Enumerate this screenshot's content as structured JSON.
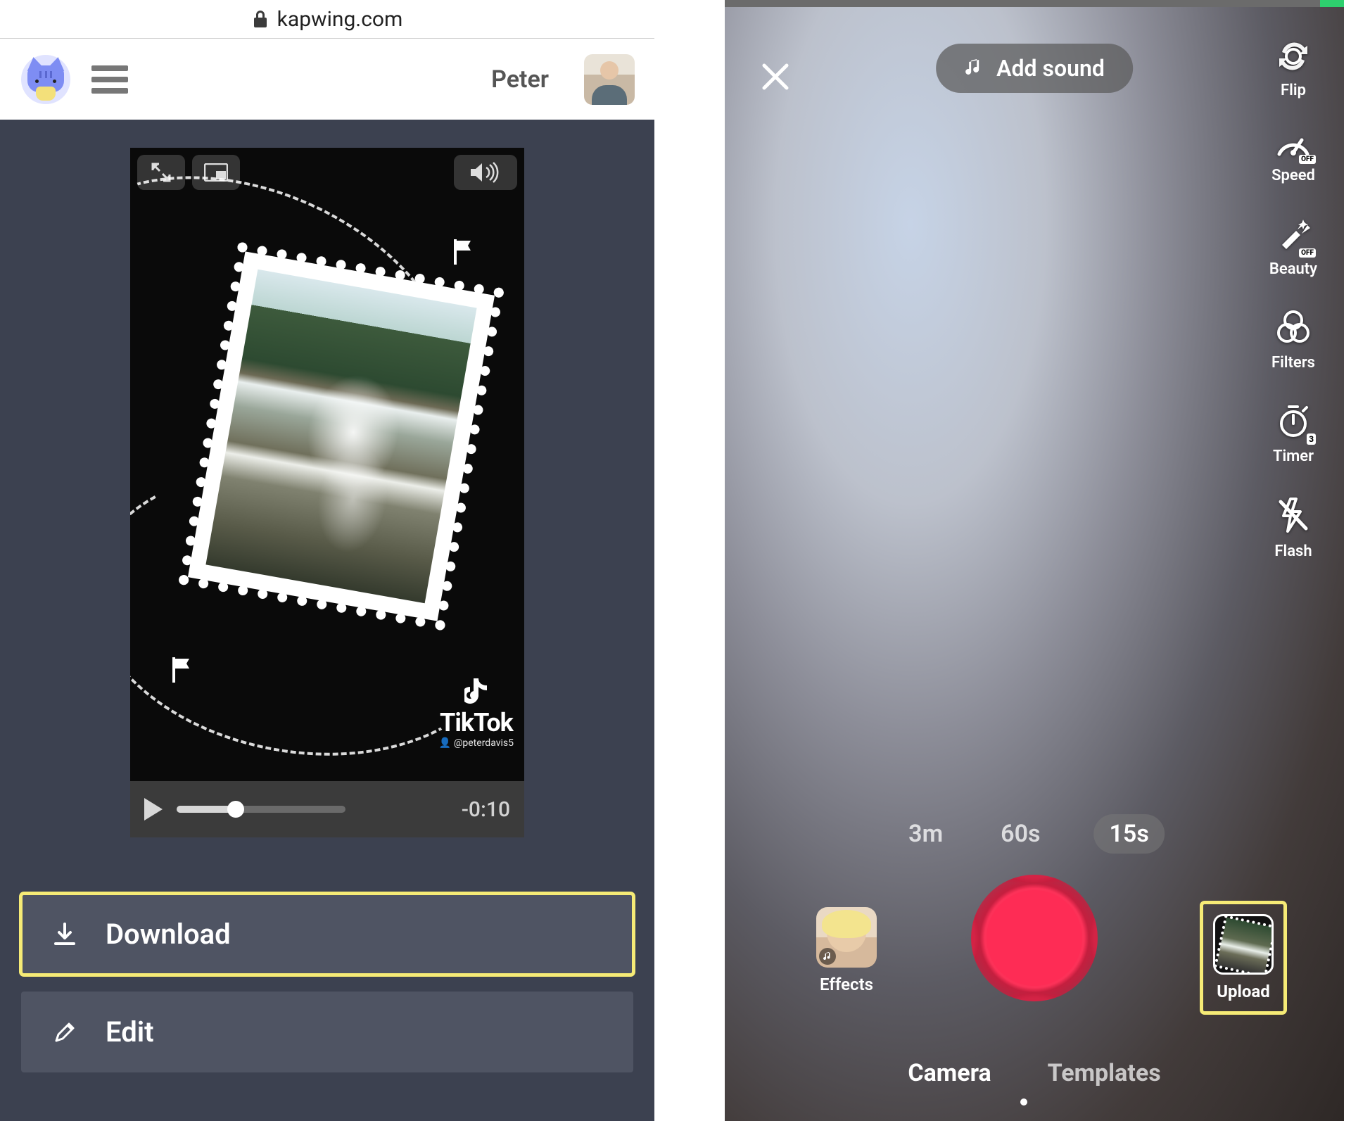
{
  "kapwing": {
    "url_domain": "kapwing.com",
    "username": "Peter",
    "watermark": {
      "brand": "TikTok",
      "handle": "@peterdavis5"
    },
    "player": {
      "timecode": "-0:10"
    },
    "buttons": {
      "download": "Download",
      "edit": "Edit"
    },
    "icons": {
      "lock": "lock-icon",
      "menu": "hamburger-icon",
      "fullscreen": "fullscreen-icon",
      "pip": "pip-icon",
      "volume": "volume-icon",
      "play": "play-icon",
      "download_icon": "download-icon",
      "edit_icon": "pencil-icon"
    }
  },
  "tiktok": {
    "add_sound": "Add sound",
    "tools": [
      {
        "key": "flip",
        "label": "Flip"
      },
      {
        "key": "speed",
        "label": "Speed",
        "badge": "OFF"
      },
      {
        "key": "beauty",
        "label": "Beauty",
        "badge": "OFF"
      },
      {
        "key": "filters",
        "label": "Filters"
      },
      {
        "key": "timer",
        "label": "Timer",
        "badge": "3"
      },
      {
        "key": "flash",
        "label": "Flash"
      }
    ],
    "durations": [
      "3m",
      "60s",
      "15s"
    ],
    "duration_selected": "15s",
    "effects_label": "Effects",
    "upload_label": "Upload",
    "modes": [
      "Camera",
      "Templates"
    ],
    "mode_selected": "Camera"
  },
  "colors": {
    "highlight": "#f6eb76",
    "record": "#fe2c55",
    "editor_bg": "#3c4150",
    "button_bg": "#4f5463"
  }
}
